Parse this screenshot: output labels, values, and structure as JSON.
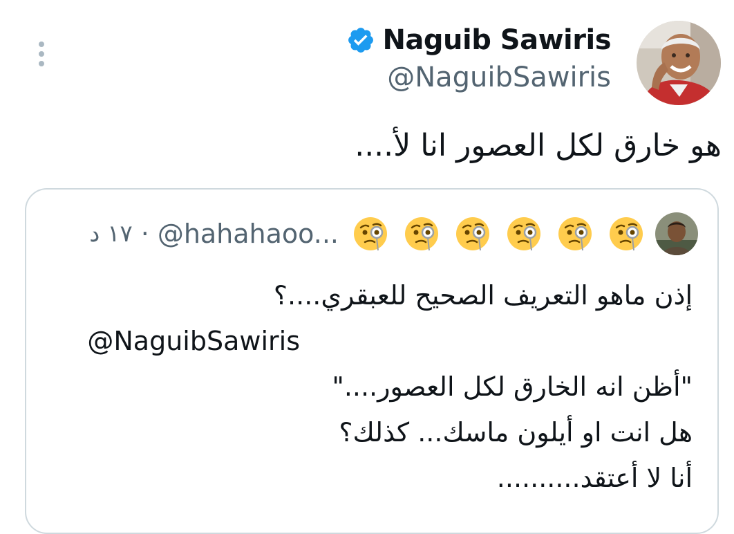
{
  "tweet": {
    "author": {
      "name": "Naguib Sawiris",
      "handle": "@NaguibSawiris",
      "verified": true,
      "verified_color": "#1d9bf0"
    },
    "text": "هو خارق لكل العصور انا لأ....",
    "more_icon": "more-options-icon"
  },
  "quoted_tweet": {
    "handle": "@hahahaoo...",
    "separator": "·",
    "time": "١٧ د",
    "name_emoji_icon": "face-with-monocle-icon",
    "name_emoji_count": 6,
    "lines": [
      "إذن ماهو التعريف الصحيح للعبقري....؟",
      "@NaguibSawiris",
      "\"أظن انه الخارق لكل العصور....\"",
      "هل انت او أيلون ماسك... كذلك؟",
      "أنا لا أعتقد.........."
    ]
  },
  "colors": {
    "text_primary": "#0f1419",
    "text_secondary": "#536471",
    "border": "#cfd9de",
    "verified_blue": "#1d9bf0",
    "emoji_yellow": "#ffcc4d"
  }
}
